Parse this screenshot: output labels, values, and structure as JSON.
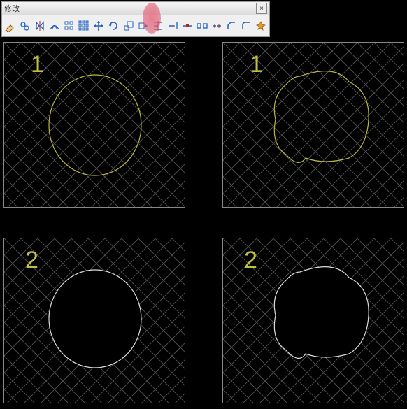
{
  "toolbar": {
    "title": "修改",
    "close_label": "×"
  },
  "panels": {
    "p1_label": "1",
    "p2_label": "1",
    "p3_label": "2",
    "p4_label": "2"
  },
  "colors": {
    "hatch": "#555555",
    "outline_top": "#b8b840",
    "outline_bottom": "#dddddd",
    "label": "#c0c040"
  }
}
